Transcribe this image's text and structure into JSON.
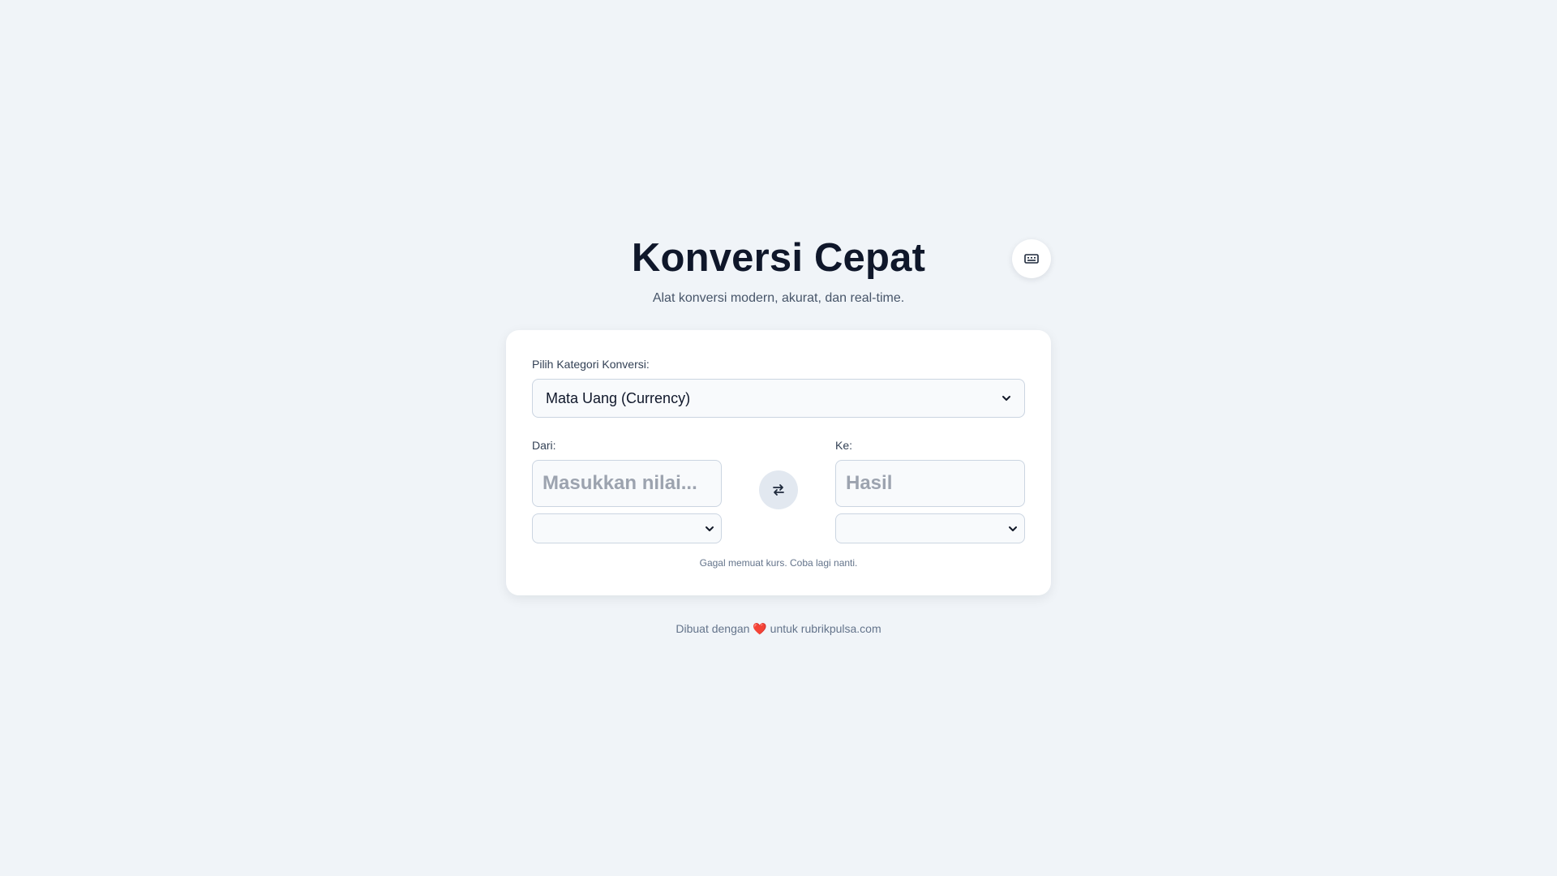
{
  "header": {
    "title": "Konversi Cepat",
    "subtitle": "Alat konversi modern, akurat, dan real-time."
  },
  "theme_toggle": {
    "icon": "keyboard-icon"
  },
  "converter": {
    "category_label": "Pilih Kategori Konversi:",
    "category_value": "Mata Uang (Currency)",
    "from_label": "Dari:",
    "from_placeholder": "Masukkan nilai...",
    "from_unit": "",
    "to_label": "Ke:",
    "to_placeholder": "Hasil",
    "to_unit": "",
    "swap_icon": "swap-arrows-icon",
    "status": "Gagal memuat kurs. Coba lagi nanti."
  },
  "footer": {
    "prefix": "Dibuat dengan",
    "heart": "❤️",
    "suffix": "untuk rubrikpulsa.com"
  },
  "colors": {
    "background": "#f0f4f8",
    "card": "#ffffff",
    "title": "#0f172a",
    "muted": "#64748b",
    "swap_bg": "#e2e8f0",
    "heart": "#e11d48"
  }
}
